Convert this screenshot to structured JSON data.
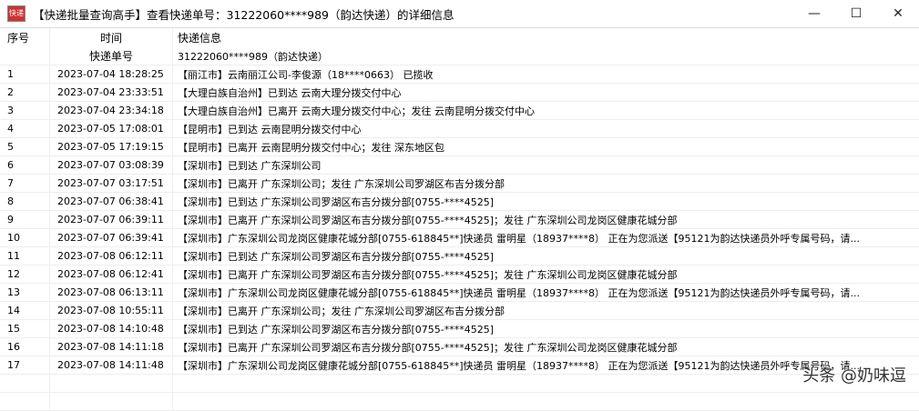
{
  "window": {
    "title": "【快递批量查询高手】查看快递单号：31222060****989（韵达快递）的详细信息",
    "minimize": "—",
    "maximize": "☐",
    "close": "✕",
    "icon_text": "快递"
  },
  "header": {
    "col_index": "序号",
    "col_time": "时间",
    "col_info": "快递信息",
    "sub_label": "快递单号",
    "sub_value": "31222060****989（韵达快递）"
  },
  "rows": [
    {
      "n": "1",
      "t": "2023-07-04 18:28:25",
      "info": "【丽江市】云南丽江公司-李俊源（18****0663） 已揽收"
    },
    {
      "n": "2",
      "t": "2023-07-04 23:33:51",
      "info": "【大理白族自治州】已到达 云南大理分拨交付中心"
    },
    {
      "n": "3",
      "t": "2023-07-04 23:34:18",
      "info": "【大理白族自治州】已离开 云南大理分拨交付中心；发往 云南昆明分拨交付中心"
    },
    {
      "n": "4",
      "t": "2023-07-05 17:08:01",
      "info": "【昆明市】已到达 云南昆明分拨交付中心"
    },
    {
      "n": "5",
      "t": "2023-07-05 17:19:15",
      "info": "【昆明市】已离开 云南昆明分拨交付中心；发往 深东地区包"
    },
    {
      "n": "6",
      "t": "2023-07-07 03:08:39",
      "info": "【深圳市】已到达 广东深圳公司"
    },
    {
      "n": "7",
      "t": "2023-07-07 03:17:51",
      "info": "【深圳市】已离开 广东深圳公司；发往 广东深圳公司罗湖区布吉分拨分部"
    },
    {
      "n": "8",
      "t": "2023-07-07 06:38:41",
      "info": "【深圳市】已到达 广东深圳公司罗湖区布吉分拨分部[0755-****4525]"
    },
    {
      "n": "9",
      "t": "2023-07-07 06:39:11",
      "info": "【深圳市】已离开 广东深圳公司罗湖区布吉分拨分部[0755-****4525]；发往 广东深圳公司龙岗区健康花城分部"
    },
    {
      "n": "10",
      "t": "2023-07-07 06:39:41",
      "info": "【深圳市】广东深圳公司龙岗区健康花城分部[0755-618845**]快递员 雷明星（18937****8） 正在为您派送【95121为韵达快递员外呼专属号码，请..."
    },
    {
      "n": "11",
      "t": "2023-07-08 06:12:11",
      "info": "【深圳市】已到达 广东深圳公司罗湖区布吉分拨分部[0755-****4525]"
    },
    {
      "n": "12",
      "t": "2023-07-08 06:12:41",
      "info": "【深圳市】已离开 广东深圳公司罗湖区布吉分拨分部[0755-****4525]；发往 广东深圳公司龙岗区健康花城分部"
    },
    {
      "n": "13",
      "t": "2023-07-08 06:13:11",
      "info": "【深圳市】广东深圳公司龙岗区健康花城分部[0755-618845**]快递员 雷明星（18937****8） 正在为您派送【95121为韵达快递员外呼专属号码，请..."
    },
    {
      "n": "14",
      "t": "2023-07-08 10:55:11",
      "info": "【深圳市】已离开 广东深圳公司；发往 广东深圳公司罗湖区布吉分拨分部"
    },
    {
      "n": "15",
      "t": "2023-07-08 14:10:48",
      "info": "【深圳市】已到达 广东深圳公司罗湖区布吉分拨分部[0755-****4525]"
    },
    {
      "n": "16",
      "t": "2023-07-08 14:11:18",
      "info": "【深圳市】已离开 广东深圳公司罗湖区布吉分拨分部[0755-****4525]；发往 广东深圳公司龙岗区健康花城分部"
    },
    {
      "n": "17",
      "t": "2023-07-08 14:11:48",
      "info": "【深圳市】广东深圳公司龙岗区健康花城分部[0755-618845**]快递员 雷明星（18937****8） 正在为您派送【95121为韵达快递员外呼专属号码，请..."
    }
  ],
  "watermark": "头条 @奶味逗"
}
